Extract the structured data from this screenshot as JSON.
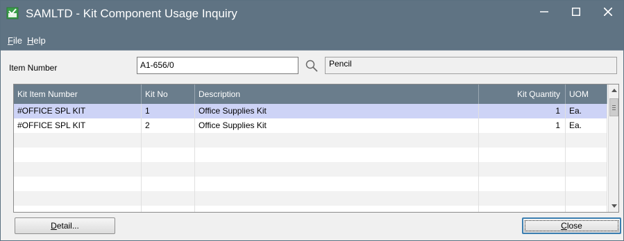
{
  "window": {
    "title": "SAMLTD - Kit Component Usage Inquiry",
    "min_glyph": "—",
    "close_glyph": "✕"
  },
  "colors": {
    "titlebar": "#5f7383",
    "grid_header": "#6a7d8c",
    "selected_row": "#cdd3f6",
    "default_button_border": "#3c7fb1",
    "app_icon_green": "#3a9d49"
  },
  "menu": {
    "file": {
      "mnemonic": "F",
      "rest": "ile"
    },
    "help": {
      "mnemonic": "H",
      "rest": "elp"
    }
  },
  "item": {
    "label": "Item Number",
    "value": "A1-656/0",
    "finder_icon": "magnifier-icon",
    "description": "Pencil"
  },
  "grid": {
    "columns": [
      "Kit Item Number",
      "Kit No",
      "Description",
      "Kit Quantity",
      "UOM"
    ],
    "rows": [
      {
        "kit_item_number": "#OFFICE SPL KIT",
        "kit_no": "1",
        "description": "Office Supplies Kit",
        "kit_quantity": "1",
        "uom": "Ea.",
        "selected": true
      },
      {
        "kit_item_number": "#OFFICE SPL KIT",
        "kit_no": "2",
        "description": "Office Supplies Kit",
        "kit_quantity": "1",
        "uom": "Ea.",
        "selected": false
      }
    ]
  },
  "buttons": {
    "detail": {
      "mnemonic": "D",
      "rest": "etail..."
    },
    "close": {
      "mnemonic": "C",
      "rest": "lose"
    }
  }
}
